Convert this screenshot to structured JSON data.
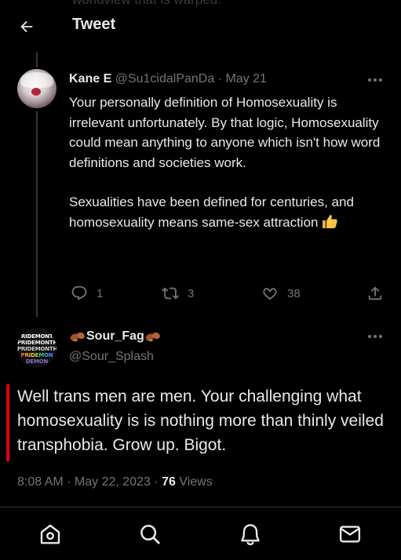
{
  "header": {
    "title": "Tweet",
    "behind_text": "worldview that is warped."
  },
  "reply": {
    "display_name": "Kane E",
    "meta": "@Su1cidalPanDa · May 21",
    "paragraph1": "Your personally definition of Homosexuality is irrelevant unfortunately. By that logic, Homosexuality could mean anything to anyone which isn't how word definitions and societies work.",
    "paragraph2": "Sexualities have been defined for centuries, and homosexuality means same-sex attraction",
    "emoji_icon": "thumbs-up-icon",
    "reply_count": "1",
    "retweet_count": "3",
    "like_count": "38"
  },
  "tweet": {
    "display_name": "Sour_Fag",
    "handle": "@Sour_Splash",
    "avatar_lines": [
      "PRIDEMONTH",
      "PRIDEMONTH",
      "PRIDEMONTH",
      "PRIDEMON",
      "DEMON"
    ],
    "text": "Well trans men are men. Your challenging what homosexuality is is nothing more than thinly veiled transphobia. Grow up. Bigot.",
    "time": "8:08 AM",
    "date": "May 22, 2023",
    "views_count": "76",
    "views_label": "Views"
  },
  "nav": [
    "home-icon",
    "search-icon",
    "notifications-icon",
    "messages-icon"
  ],
  "colors": {
    "background": "#000000",
    "text": "#e7e9ea",
    "muted": "#71767b",
    "divider": "#2f3336",
    "accent_bar": "#e0000f"
  }
}
